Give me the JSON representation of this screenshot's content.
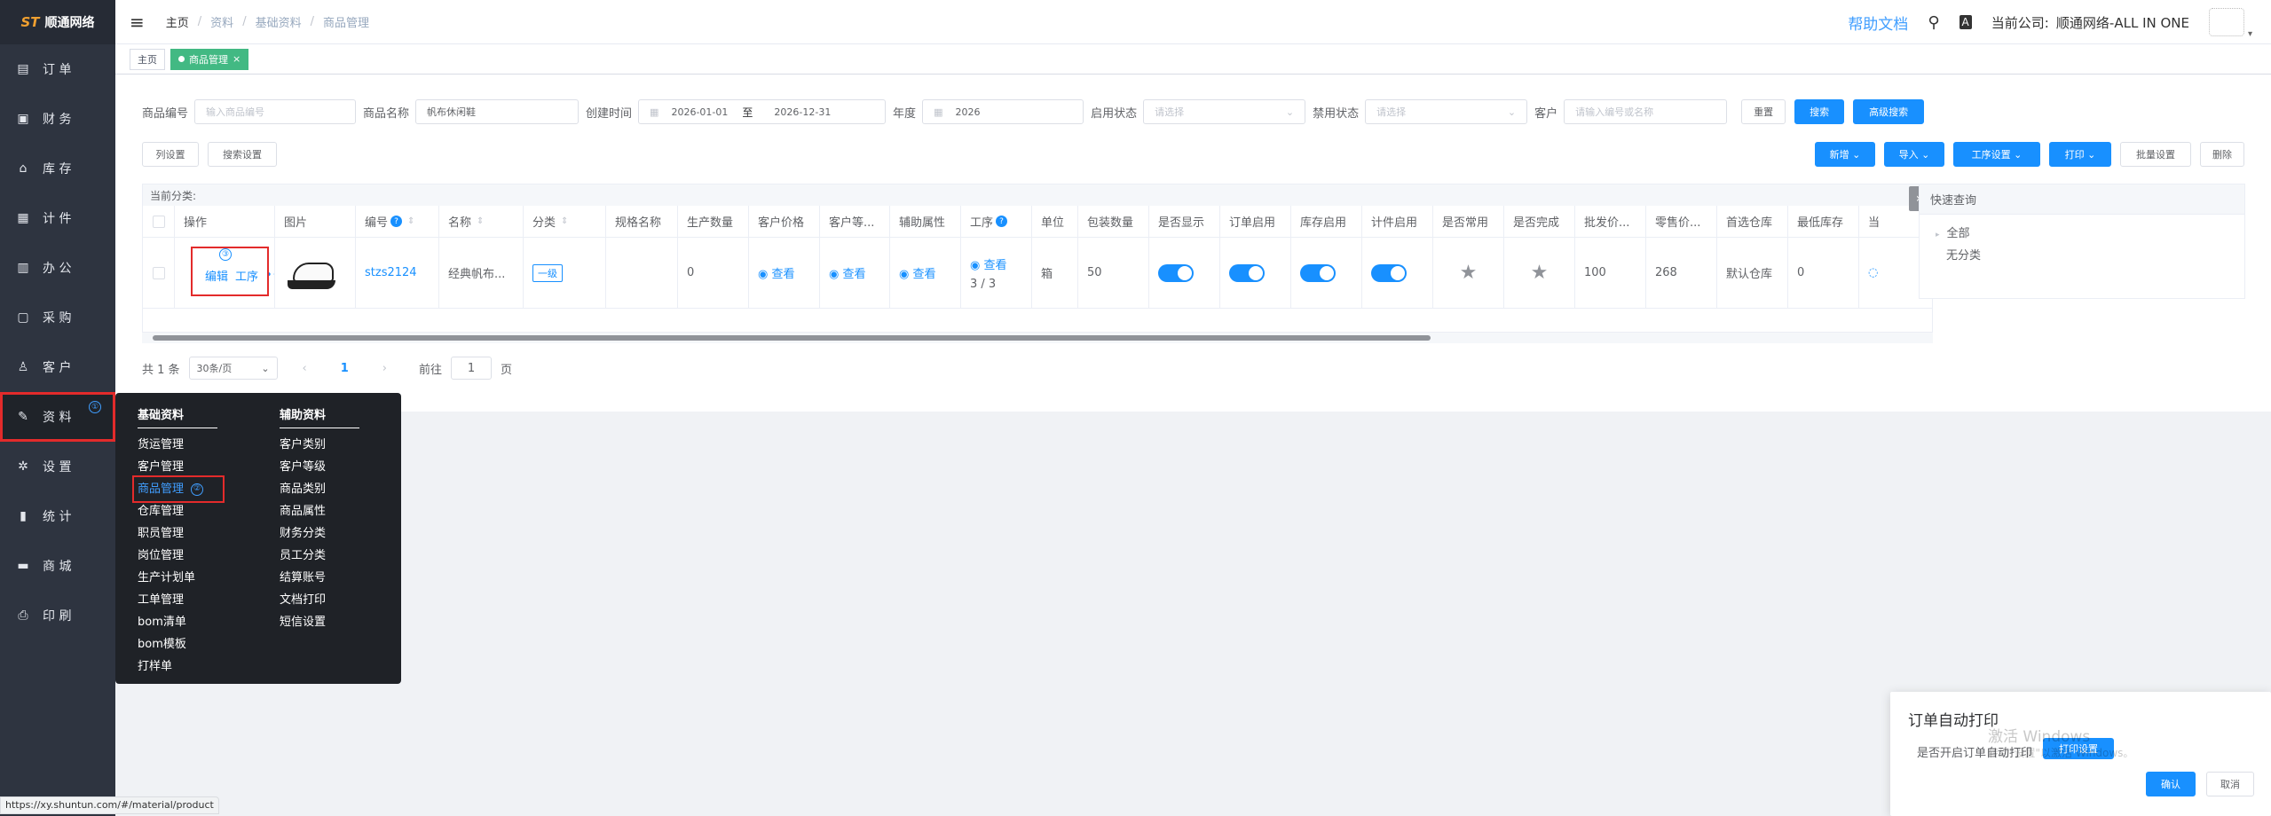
{
  "logo": {
    "mark": "ST",
    "text": "顺通网络"
  },
  "sidebar": {
    "items": [
      {
        "icon": "book-icon",
        "glyph": "▤",
        "label": "订 单"
      },
      {
        "icon": "wallet-icon",
        "glyph": "▣",
        "label": "财 务"
      },
      {
        "icon": "home-icon",
        "glyph": "⌂",
        "label": "库 存"
      },
      {
        "icon": "clipboard-icon",
        "glyph": "▦",
        "label": "计 件"
      },
      {
        "icon": "calendar-icon",
        "glyph": "▥",
        "label": "办 公"
      },
      {
        "icon": "bag-icon",
        "glyph": "▢",
        "label": "采 购"
      },
      {
        "icon": "user-icon",
        "glyph": "♙",
        "label": "客 户"
      },
      {
        "icon": "edit-icon",
        "glyph": "✎",
        "label": "资 料",
        "badge": "①"
      },
      {
        "icon": "gear-icon",
        "glyph": "✲",
        "label": "设 置"
      },
      {
        "icon": "bar-chart-icon",
        "glyph": "▮",
        "label": "统 计"
      },
      {
        "icon": "store-icon",
        "glyph": "▬",
        "label": "商 城"
      },
      {
        "icon": "printer-icon",
        "glyph": "⎙",
        "label": "印 刷"
      }
    ]
  },
  "header": {
    "breadcrumb": [
      "主页",
      "资料",
      "基础资料",
      "商品管理"
    ],
    "help": "帮助文档",
    "company_label": "当前公司:",
    "company_name": "顺通网络-ALL IN ONE"
  },
  "tags": {
    "home": "主页",
    "current": "商品管理",
    "close": "×"
  },
  "filters": {
    "code_label": "商品编号",
    "code_placeholder": "输入商品编号",
    "name_label": "商品名称",
    "name_value": "帆布休闲鞋",
    "created_label": "创建时间",
    "date_start": "2026-01-01",
    "date_sep": "至",
    "date_end": "2026-12-31",
    "year_label": "年度",
    "year_value": "2026",
    "enabled_label": "启用状态",
    "enabled_placeholder": "请选择",
    "disabled_label": "禁用状态",
    "disabled_placeholder": "请选择",
    "customer_label": "客户",
    "customer_placeholder": "请输入编号或名称",
    "reset": "重置",
    "search": "搜索",
    "advanced": "高级搜索"
  },
  "toolbar": {
    "col_settings": "列设置",
    "search_settings": "搜索设置",
    "add": "新增",
    "import": "导入",
    "process_settings": "工序设置",
    "print": "打印",
    "batch_settings": "批量设置",
    "delete": "删除"
  },
  "table": {
    "category_label": "当前分类:",
    "headers": [
      "操作",
      "图片",
      "编号",
      "名称",
      "分类",
      "规格名称",
      "生产数量",
      "客户价格",
      "客户等...",
      "辅助属性",
      "工序",
      "单位",
      "包装数量",
      "是否显示",
      "订单启用",
      "库存启用",
      "计件启用",
      "是否常用",
      "是否完成",
      "批发价...",
      "零售价...",
      "首选仓库",
      "最低库存",
      "当"
    ],
    "row": {
      "edit": "编辑",
      "process": "工序",
      "more": "•••",
      "step_badge": "③",
      "code": "stzs2124",
      "name": "经典帆布...",
      "category": "一级",
      "spec": "",
      "qty": "0",
      "view": "查看",
      "process_count": "3 / 3",
      "unit": "箱",
      "pack_qty": "50",
      "wholesale": "100",
      "retail": "268",
      "warehouse": "默认仓库",
      "min_stock": "0"
    }
  },
  "pager": {
    "total": "共 1 条",
    "per_page": "30条/页",
    "page": "1",
    "goto": "前往",
    "goto_value": "1",
    "page_unit": "页"
  },
  "quick": {
    "title": "快速查询",
    "all": "全部",
    "none": "无分类"
  },
  "flyout": {
    "basic_title": "基础资料",
    "basic": [
      "货运管理",
      "客户管理",
      "商品管理",
      "仓库管理",
      "职员管理",
      "岗位管理",
      "生产计划单",
      "工单管理",
      "bom清单",
      "bom模板",
      "打样单"
    ],
    "basic_badge": "②",
    "aux_title": "辅助资料",
    "aux": [
      "客户类别",
      "客户等级",
      "商品类别",
      "商品属性",
      "财务分类",
      "员工分类",
      "结算账号",
      "文档打印",
      "短信设置"
    ]
  },
  "dialog": {
    "title": "订单自动打印",
    "text": "是否开启订单自动打印",
    "print_settings": "打印设置",
    "confirm": "确认",
    "cancel": "取消",
    "watermark1": "激活 Windows",
    "watermark2": "转到\"设置\"以激活 Windows。"
  },
  "status_url": "https://xy.shuntun.com/#/material/product"
}
